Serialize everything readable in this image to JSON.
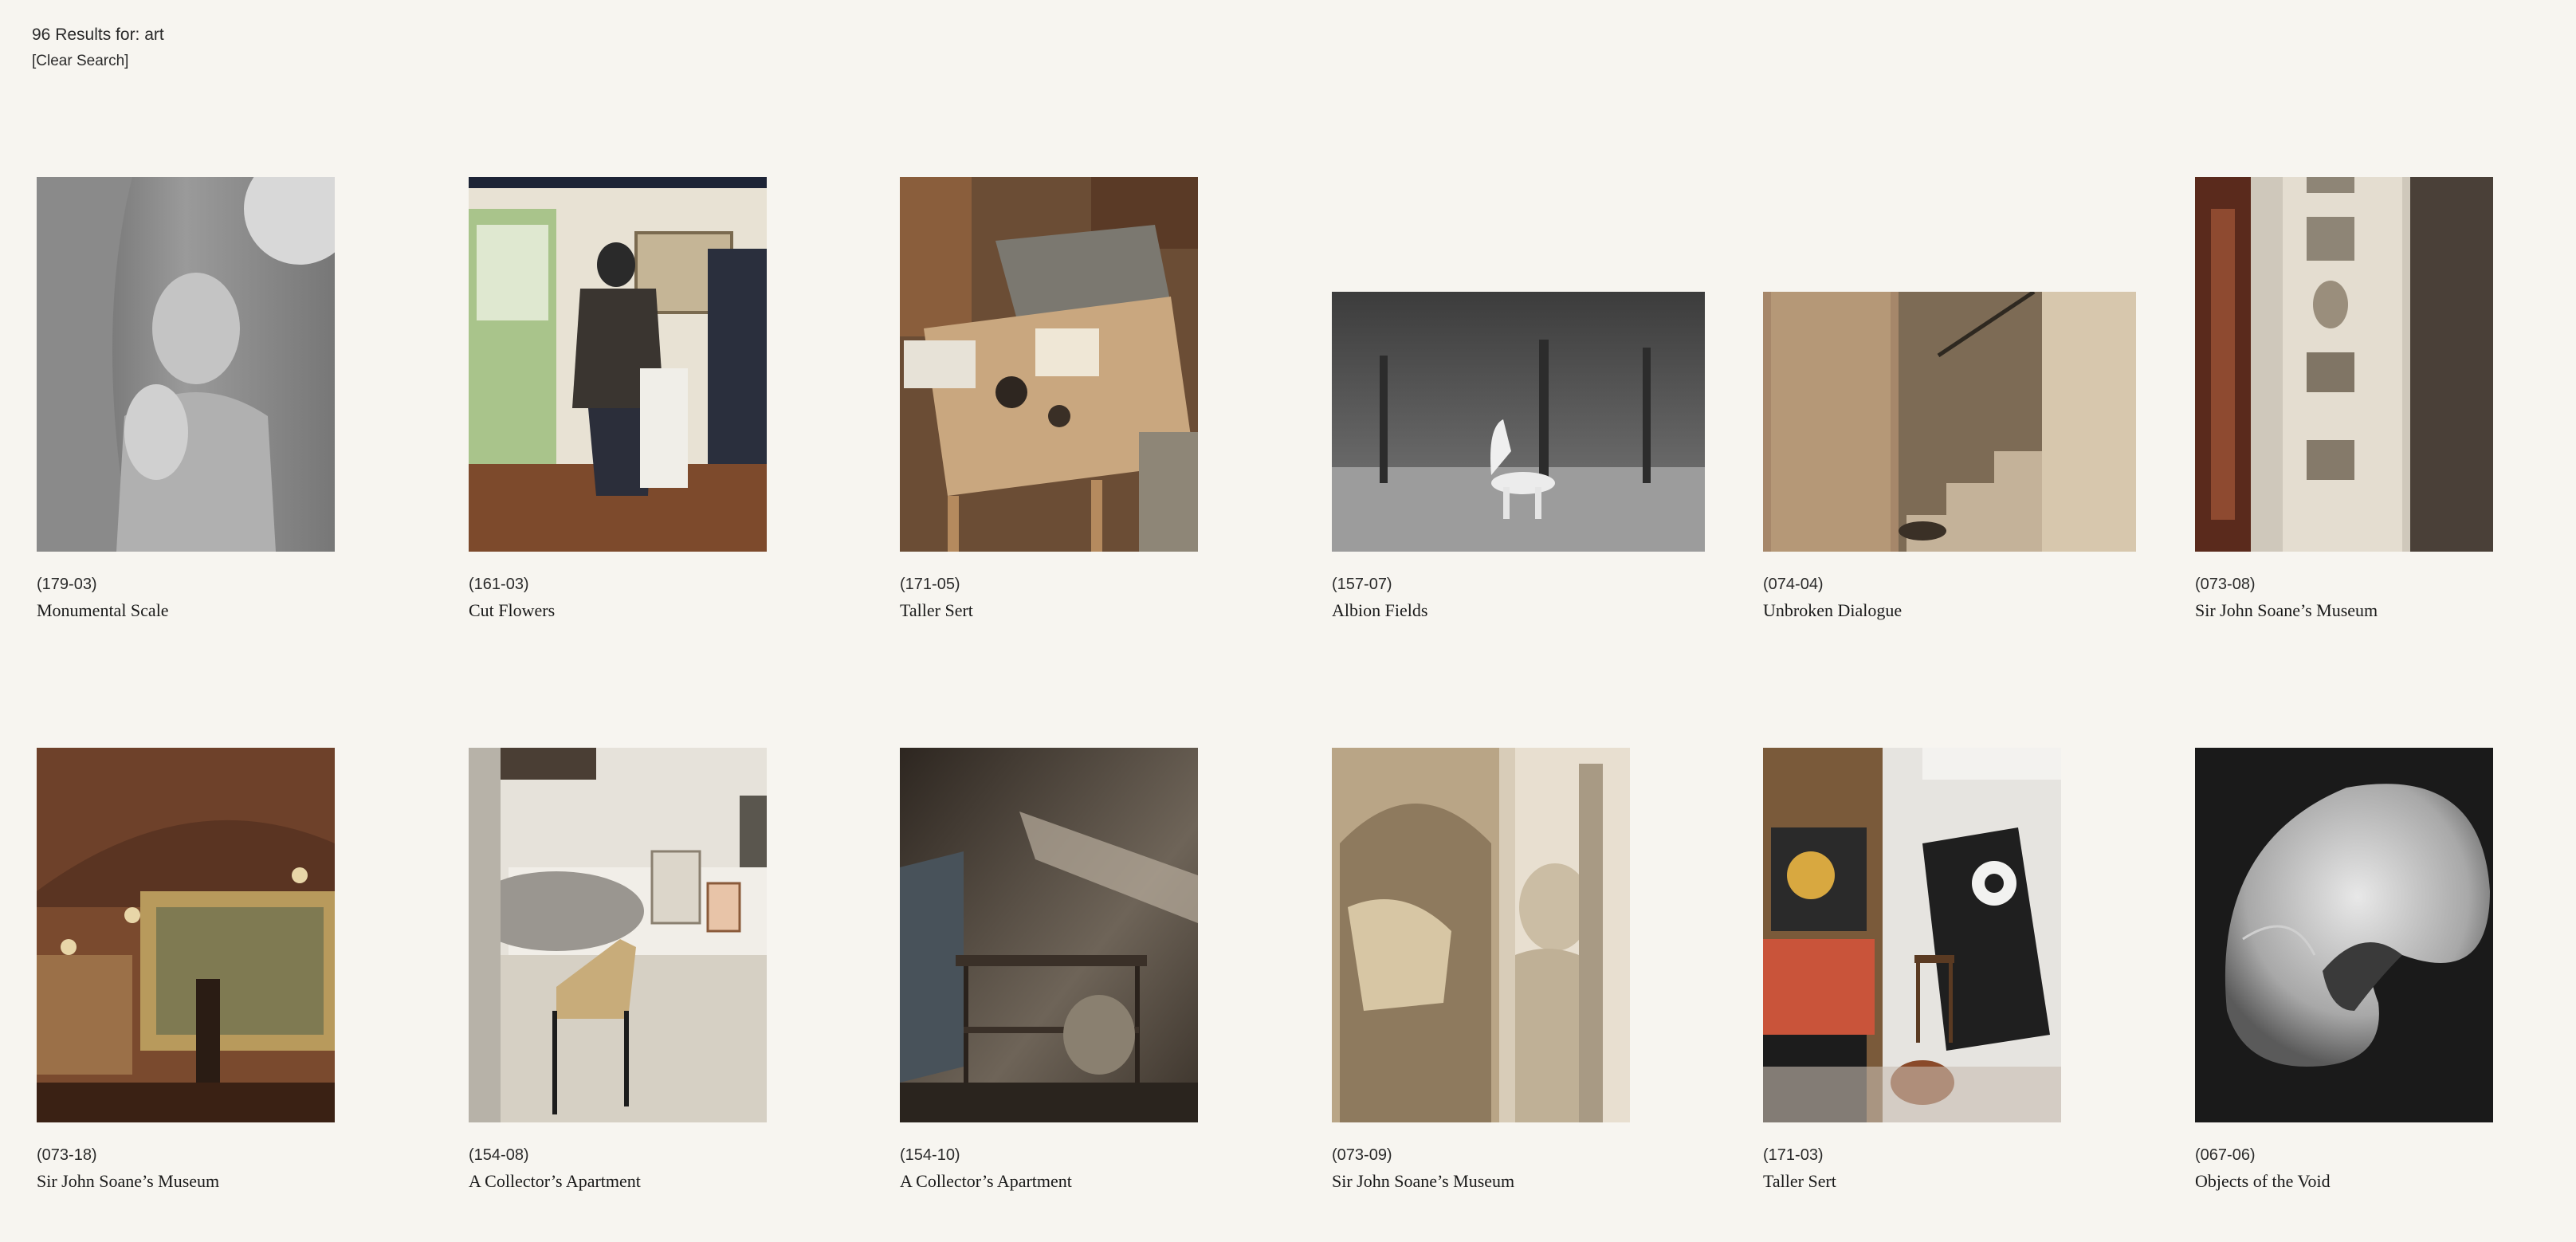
{
  "search": {
    "results_text": "96 Results for: art",
    "clear_label": "[Clear Search]"
  },
  "results": [
    {
      "code": "(179-03)",
      "title": "Monumental Scale",
      "image": "portrait-man-sculpture-bw"
    },
    {
      "code": "(161-03)",
      "title": "Cut Flowers",
      "image": "studio-person-at-window"
    },
    {
      "code": "(171-05)",
      "title": "Taller Sert",
      "image": "studio-work-table"
    },
    {
      "code": "(157-07)",
      "title": "Albion Fields",
      "image": "white-horse-field-bw"
    },
    {
      "code": "(074-04)",
      "title": "Unbroken Dialogue",
      "image": "doorway-stairs"
    },
    {
      "code": "(073-08)",
      "title": "Sir John Soane’s Museum",
      "image": "wall-plaster-casts"
    },
    {
      "code": "(073-18)",
      "title": "Sir John Soane’s Museum",
      "image": "gallery-painting-statue"
    },
    {
      "code": "(154-08)",
      "title": "A Collector’s Apartment",
      "image": "apartment-chair-artworks"
    },
    {
      "code": "(154-10)",
      "title": "A Collector’s Apartment",
      "image": "apartment-side-table"
    },
    {
      "code": "(073-09)",
      "title": "Sir John Soane’s Museum",
      "image": "niche-bust-sculpture"
    },
    {
      "code": "(171-03)",
      "title": "Taller Sert",
      "image": "studio-miro-canvases"
    },
    {
      "code": "(067-06)",
      "title": "Objects of the Void",
      "image": "stone-sculpture-bw"
    }
  ]
}
